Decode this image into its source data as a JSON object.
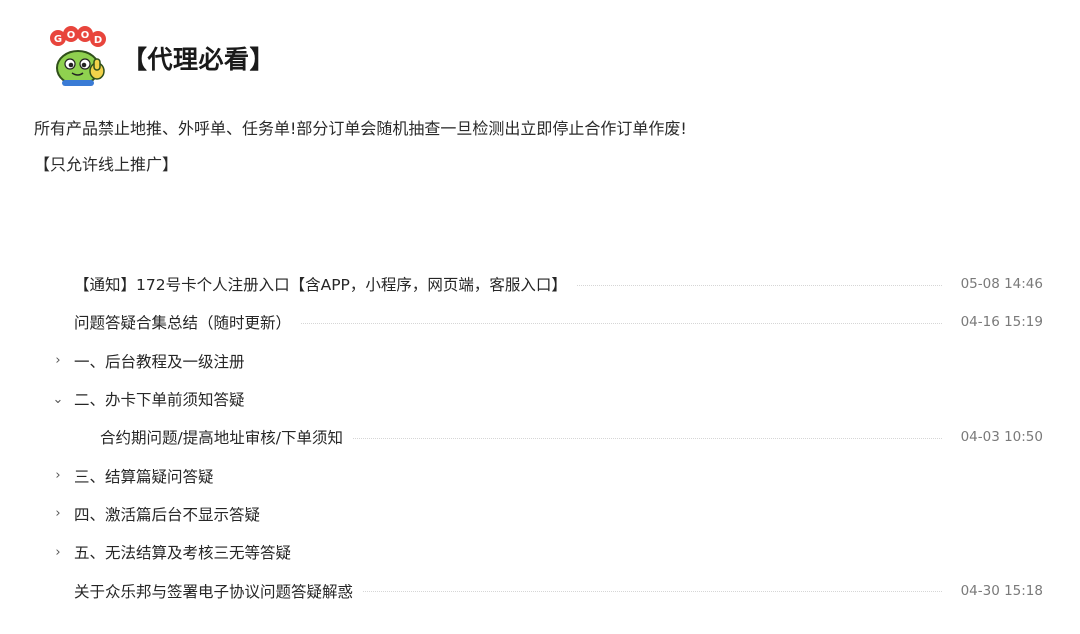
{
  "header": {
    "title": "【代理必看】",
    "logo_text": "GOOD"
  },
  "notice": {
    "line1": "所有产品禁止地推、外呼单、任务单!部分订单会随机抽查一旦检测出立即停止合作订单作废!",
    "line2": "【只允许线上推广】"
  },
  "items": [
    {
      "label": "【通知】172号卡个人注册入口【含APP，小程序，网页端，客服入口】",
      "date": "05-08 14:46",
      "chevron": ""
    },
    {
      "label": "问题答疑合集总结（随时更新）",
      "date": "04-16 15:19",
      "chevron": ""
    },
    {
      "label": "一、后台教程及一级注册",
      "date": "",
      "chevron": "›"
    },
    {
      "label": "二、办卡下单前须知答疑",
      "date": "",
      "chevron": "⌄"
    },
    {
      "label": "合约期问题/提高地址审核/下单须知",
      "date": "04-03 10:50",
      "chevron": ""
    },
    {
      "label": "三、结算篇疑问答疑",
      "date": "",
      "chevron": "›"
    },
    {
      "label": "四、激活篇后台不显示答疑",
      "date": "",
      "chevron": "›"
    },
    {
      "label": "五、无法结算及考核三无等答疑",
      "date": "",
      "chevron": "›"
    },
    {
      "label": "关于众乐邦与签署电子协议问题答疑解惑",
      "date": "04-30 15:18",
      "chevron": ""
    }
  ]
}
